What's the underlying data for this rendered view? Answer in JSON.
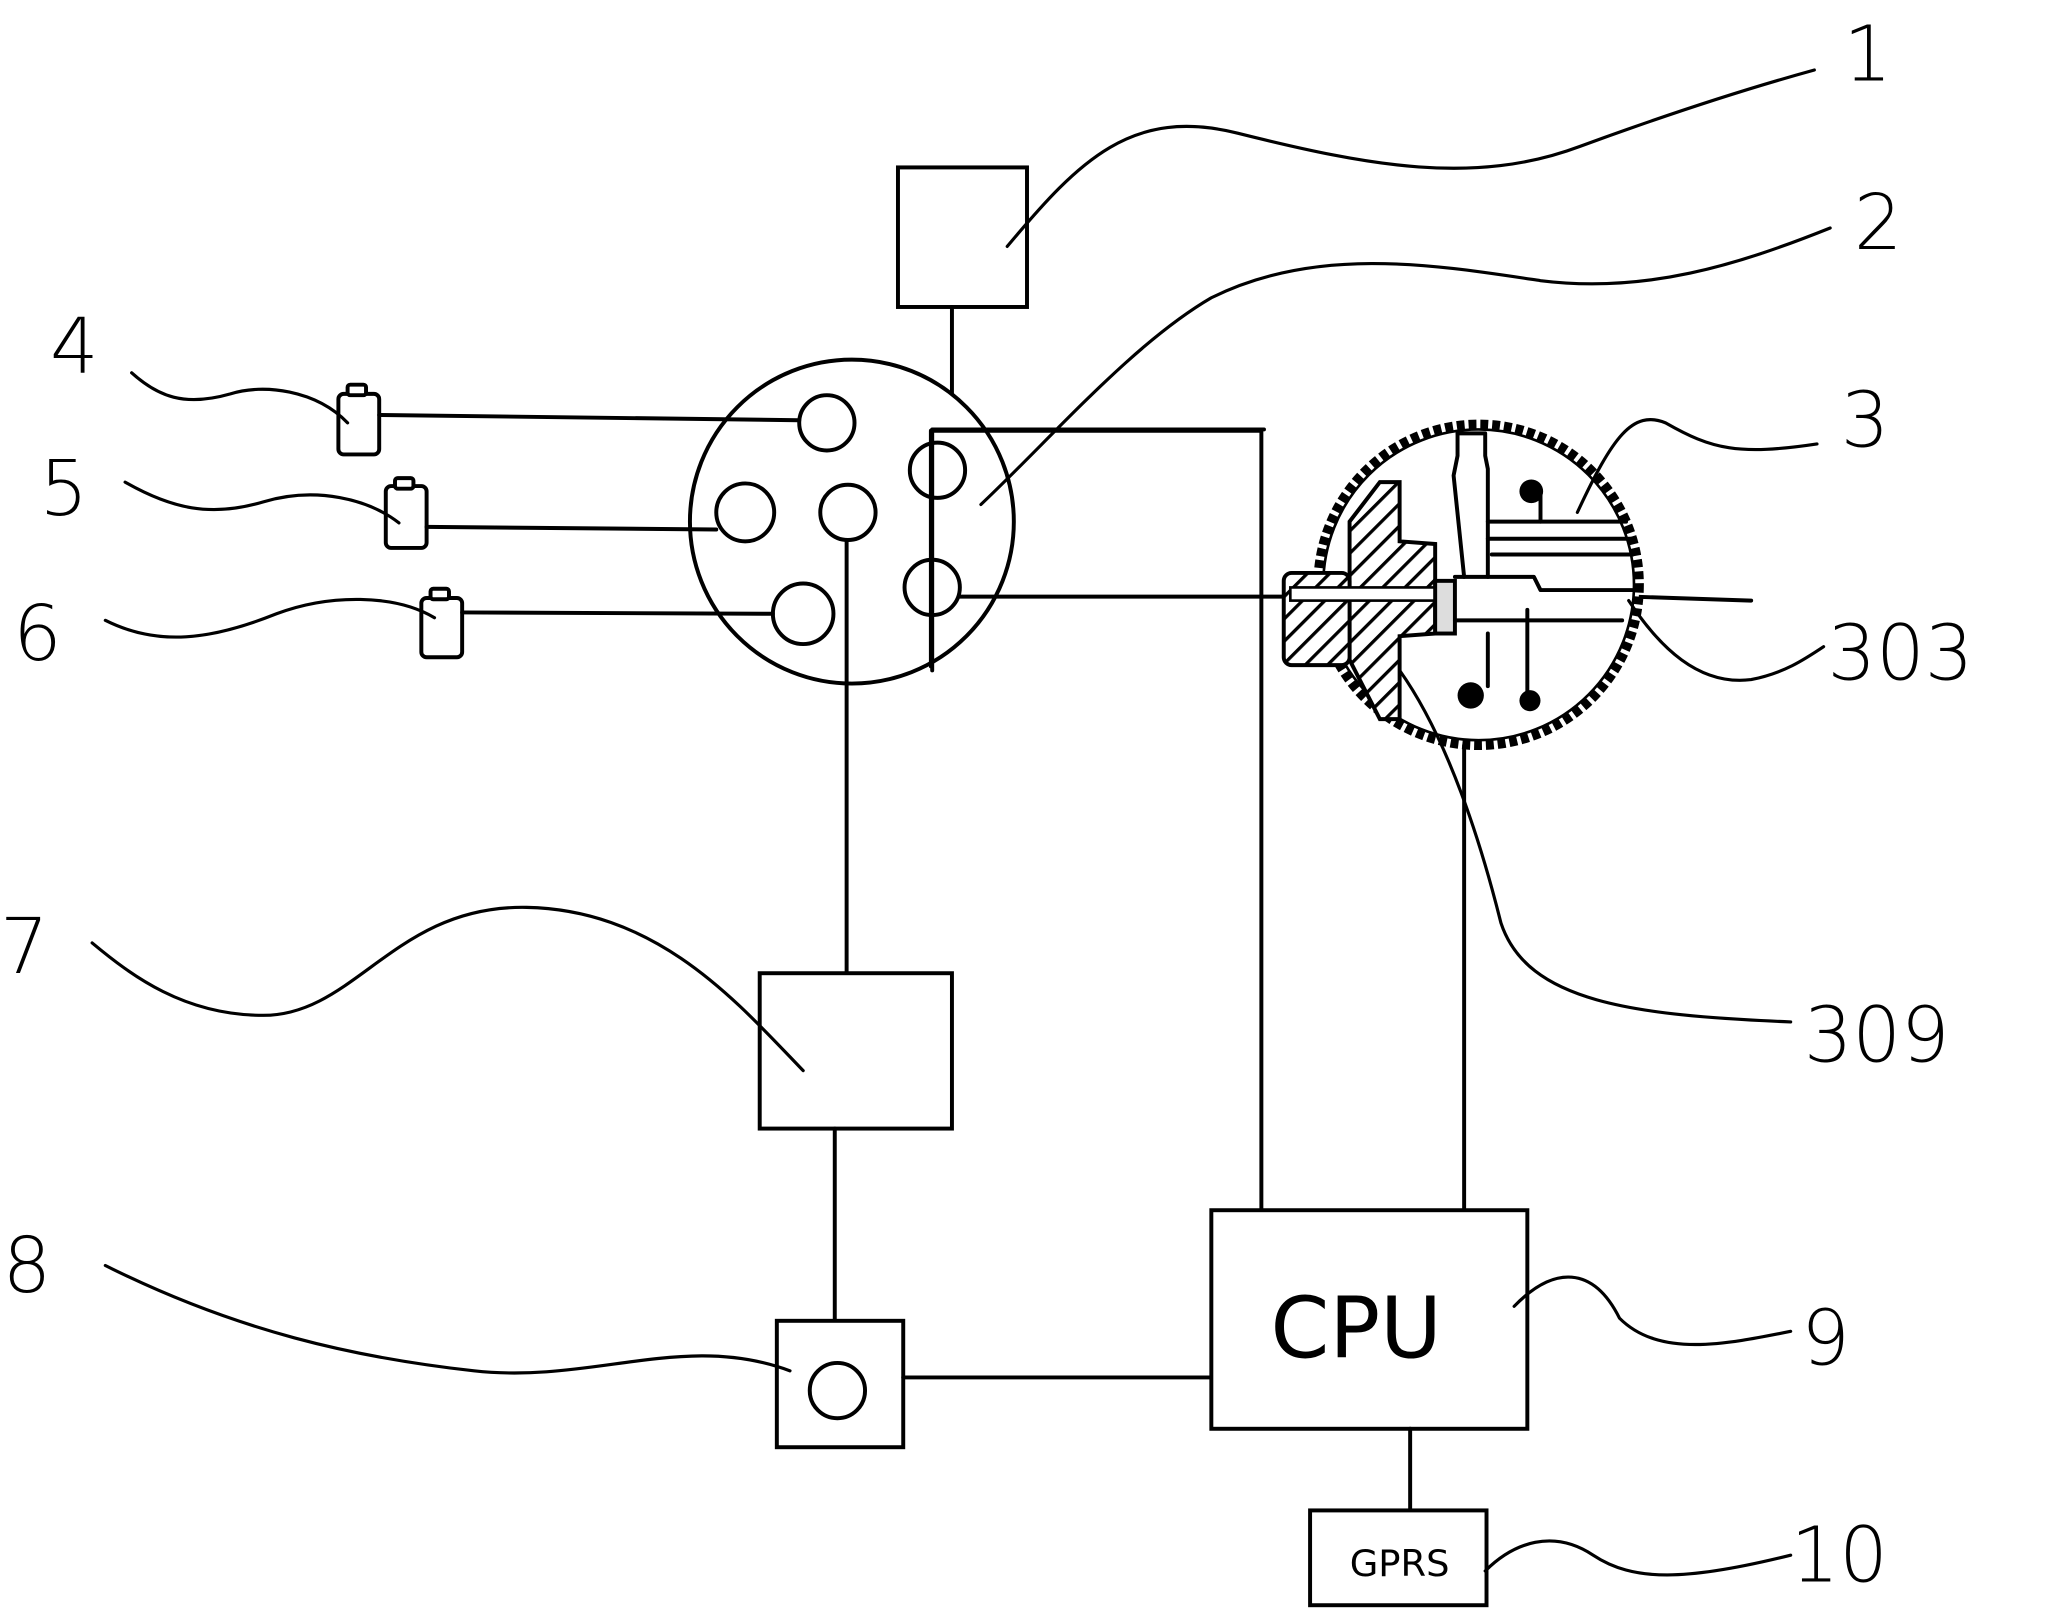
{
  "figure": {
    "type": "patent block diagram",
    "components": [
      {
        "ref": "1",
        "label": "",
        "shape": "box"
      },
      {
        "ref": "2",
        "label": "",
        "shape": "multi-port connector disc"
      },
      {
        "ref": "3",
        "label": "",
        "shape": "sensor cross-section"
      },
      {
        "ref": "4",
        "label": "",
        "shape": "small cylinder"
      },
      {
        "ref": "5",
        "label": "",
        "shape": "small cylinder"
      },
      {
        "ref": "6",
        "label": "",
        "shape": "small cylinder"
      },
      {
        "ref": "7",
        "label": "",
        "shape": "box"
      },
      {
        "ref": "8",
        "label": "",
        "shape": "box with circle"
      },
      {
        "ref": "9",
        "label": "CPU",
        "shape": "box"
      },
      {
        "ref": "10",
        "label": "GPRS",
        "shape": "box"
      }
    ],
    "sub_refs": [
      "303",
      "309"
    ]
  },
  "labels": {
    "n1": "1",
    "n2": "2",
    "n3": "3",
    "n4": "4",
    "n5": "5",
    "n6": "6",
    "n7": "7",
    "n8": "8",
    "n9": "9",
    "n10": "10",
    "n303": "303",
    "n309": "309"
  },
  "boxes": {
    "cpu": "CPU",
    "gprs": "GPRS"
  }
}
